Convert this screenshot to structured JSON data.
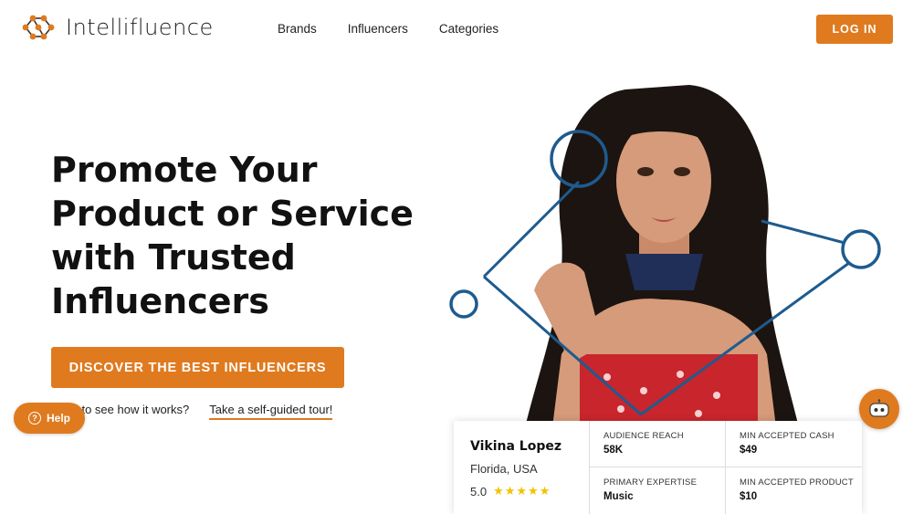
{
  "header": {
    "logo_text": "Intellifluence",
    "nav": [
      {
        "label": "Brands"
      },
      {
        "label": "Influencers"
      },
      {
        "label": "Categories"
      }
    ],
    "login_label": "LOG IN"
  },
  "hero": {
    "title": "Promote Your Product or Service with Trusted Influencers",
    "cta_label": "DISCOVER THE BEST INFLUENCERS",
    "tour_prompt": "Want to see how it works?",
    "tour_link": "Take a self-guided tour!"
  },
  "help": {
    "label": "Help"
  },
  "influencer": {
    "name": "Vikina Lopez",
    "location": "Florida, USA",
    "rating": "5.0",
    "stars": "★★★★★",
    "stats": [
      {
        "label": "AUDIENCE REACH",
        "value": "58K"
      },
      {
        "label": "MIN ACCEPTED CASH",
        "value": "$49"
      },
      {
        "label": "PRIMARY EXPERTISE",
        "value": "Music"
      },
      {
        "label": "MIN ACCEPTED PRODUCT",
        "value": "$10"
      }
    ]
  },
  "colors": {
    "accent": "#e07a1f",
    "network": "#1e5b8f"
  },
  "icons": [
    "logo-network-icon",
    "help-question-icon",
    "chat-bot-icon",
    "star-icon"
  ]
}
